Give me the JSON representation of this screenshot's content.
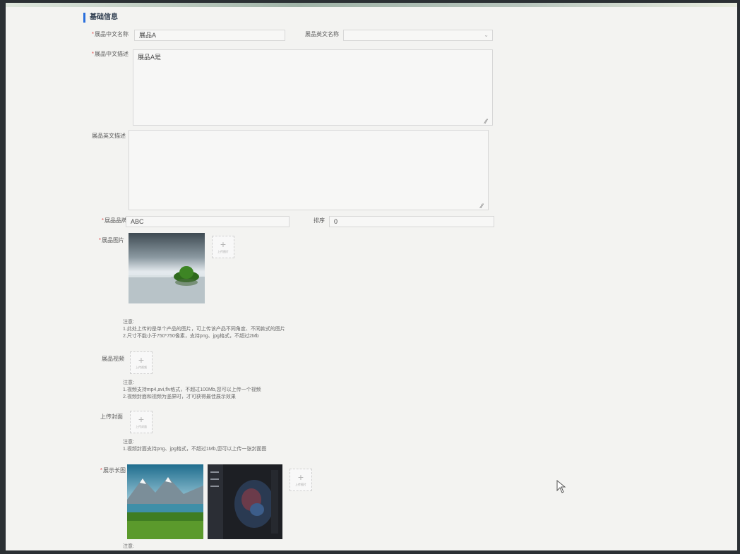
{
  "section": {
    "title": "基础信息"
  },
  "fields": {
    "cn_name": {
      "label": "展品中文名称",
      "value": "展品A"
    },
    "en_name": {
      "label": "展品英文名称",
      "value": ""
    },
    "cn_desc": {
      "label": "展品中文描述",
      "value": "展品A是"
    },
    "en_desc": {
      "label": "展品英文描述",
      "value": ""
    },
    "brand": {
      "label": "展品品牌",
      "value": "ABC"
    },
    "sort": {
      "label": "排序",
      "value": "0"
    }
  },
  "image": {
    "label": "展品图片",
    "upload_caption": "上传图片",
    "notes": [
      "注意:",
      "1.此处上传的是单个产品的图片，可上传该产品不同角度、不同款式的图片",
      "2.尺寸不能小于750*750像素，支持png、jpg格式，不超过2Mb"
    ]
  },
  "video": {
    "label": "展品视频",
    "upload_caption": "上传视频",
    "notes": [
      "注意:",
      "1.视频支持mp4,avi,flv格式，不超过100Mb,您可以上传一个视频",
      "2.视频封面和视频为竖屏时，才可获得最佳展示效果"
    ]
  },
  "cover": {
    "label": "上传封面",
    "upload_caption": "上传封面",
    "notes": [
      "注意:",
      "1.视频封面支持png、jpg格式，不超过1Mb,您可以上传一张封面图"
    ]
  },
  "display": {
    "label": "展示长图",
    "upload_caption": "上传图片",
    "notes": [
      "注意:"
    ]
  },
  "colors": {
    "accent": "#2a6fdc",
    "required": "#e15a5a"
  }
}
